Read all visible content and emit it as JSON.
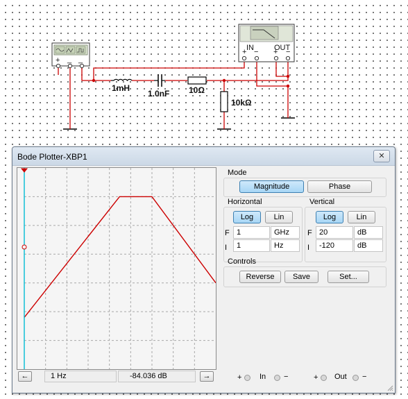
{
  "schematic": {
    "inductor_label": "1mH",
    "capacitor_label": "1.0nF",
    "resistor_series_label": "10Ω",
    "resistor_shunt_label": "10kΩ",
    "bode_in_label": "IN",
    "bode_out_label": "OUT"
  },
  "window": {
    "title": "Bode Plotter-XBP1",
    "close_label": "✕"
  },
  "mode": {
    "group_label": "Mode",
    "magnitude_label": "Magnitude",
    "phase_label": "Phase"
  },
  "horizontal": {
    "group_label": "Horizontal",
    "log_label": "Log",
    "lin_label": "Lin",
    "f_tag": "F",
    "i_tag": "I",
    "f_value": "1",
    "f_unit": "GHz",
    "i_value": "1",
    "i_unit": "Hz"
  },
  "vertical": {
    "group_label": "Vertical",
    "log_label": "Log",
    "lin_label": "Lin",
    "f_tag": "F",
    "i_tag": "I",
    "f_value": "20",
    "f_unit": "dB",
    "i_value": "-120",
    "i_unit": "dB"
  },
  "controls": {
    "group_label": "Controls",
    "reverse_label": "Reverse",
    "save_label": "Save",
    "set_label": "Set..."
  },
  "status": {
    "left_arrow": "←",
    "right_arrow": "→",
    "frequency_readout": "1 Hz",
    "magnitude_readout": "-84.036 dB"
  },
  "terminals": {
    "plus": "+",
    "minus": "−",
    "in_label": "In",
    "out_label": "Out"
  },
  "colors": {
    "trace": "#cc0000",
    "cursor": "#00bcd4",
    "wire": "#cc0000",
    "active_button": "#a7d6f5"
  },
  "chart_data": {
    "type": "line",
    "xscale": "log",
    "xlim": [
      "1 Hz",
      "1 GHz"
    ],
    "ylim": [
      -120,
      20
    ],
    "yunit": "dB",
    "grid": true,
    "cursor_x": "1 Hz",
    "cursor_y": -84.036,
    "series": [
      {
        "points": [
          {
            "x": 1,
            "y": -84
          },
          {
            "x": 30000,
            "y": 0
          },
          {
            "x": 1000000,
            "y": 0
          },
          {
            "x": 1000000000,
            "y": -60
          }
        ]
      }
    ]
  }
}
